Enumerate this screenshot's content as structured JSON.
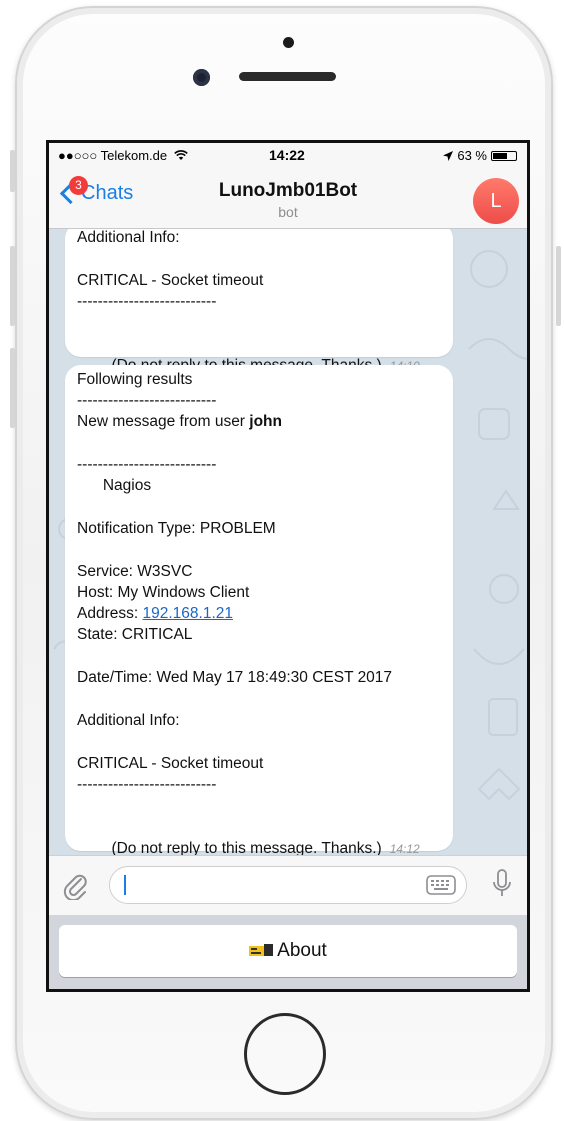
{
  "status_bar": {
    "carrier": "●●○○○ Telekom.de",
    "time": "14:22",
    "battery": "63 %",
    "battery_level": 0.63
  },
  "nav": {
    "back_label": "Chats",
    "unread_badge": "3",
    "title": "LunoJmb01Bot",
    "subtitle": "bot",
    "avatar_initial": "L"
  },
  "messages": [
    {
      "lines": [
        "Additional Info:",
        "",
        "CRITICAL - Socket timeout",
        "---------------------------",
        ""
      ],
      "last_line": "(Do not reply to this message. Thanks.)",
      "time": "14:10"
    },
    {
      "line_1": "Following results",
      "line_2": "---------------------------",
      "line_3_prefix": "New message from user ",
      "line_3_user": "john",
      "line_5": "---------------------------",
      "line_6": "      Nagios",
      "line_8": "Notification Type: PROBLEM",
      "line_10": "Service: W3SVC",
      "line_11": "Host: My Windows Client",
      "line_12_prefix": "Address: ",
      "line_12_link": "192.168.1.21",
      "line_13": "State: CRITICAL",
      "line_15": "Date/Time: Wed May 17 18:49:30 CEST 2017",
      "line_17": "Additional Info:",
      "line_19": "CRITICAL - Socket timeout",
      "line_20": "---------------------------",
      "last_line": "(Do not reply to this message. Thanks.)",
      "time": "14:12"
    }
  ],
  "input": {
    "placeholder": ""
  },
  "keyboard_button": {
    "label": "About"
  },
  "icons": [
    "paperclip-icon",
    "keyboard-icon",
    "microphone-icon",
    "wifi-icon",
    "location-arrow-icon",
    "battery-icon",
    "back-chevron-icon",
    "about-emoji-icon"
  ]
}
